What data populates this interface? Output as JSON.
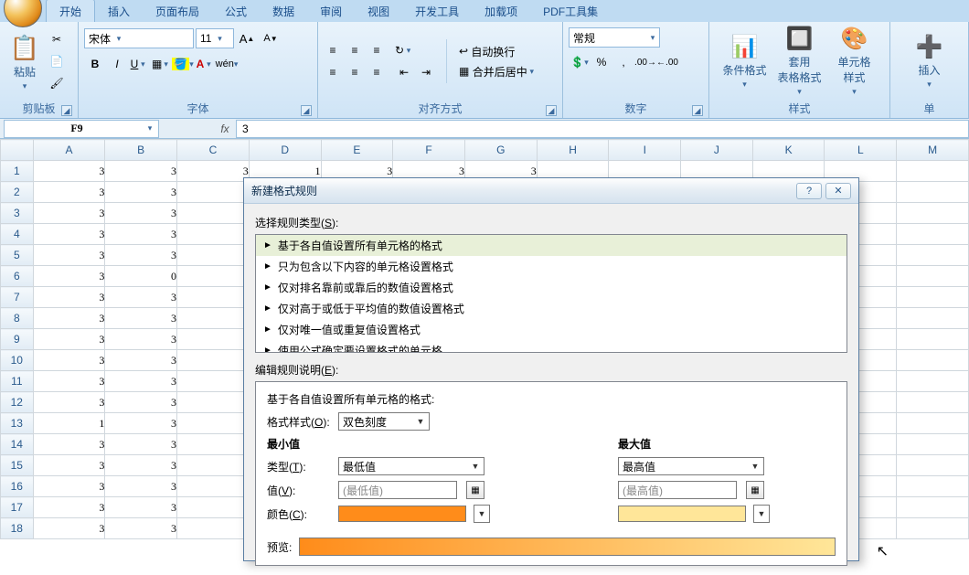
{
  "ribbon": {
    "tabs": [
      "开始",
      "插入",
      "页面布局",
      "公式",
      "数据",
      "审阅",
      "视图",
      "开发工具",
      "加载项",
      "PDF工具集"
    ],
    "active": 0,
    "clipboard": {
      "paste": "粘贴",
      "group": "剪贴板"
    },
    "font": {
      "group": "字体",
      "name": "宋体",
      "size": "11",
      "buttons": {
        "bold": "B",
        "italic": "I",
        "underline": "U"
      }
    },
    "alignment": {
      "group": "对齐方式",
      "wrap": "自动换行",
      "merge": "合并后居中"
    },
    "number": {
      "group": "数字",
      "format": "常规"
    },
    "styles": {
      "group": "样式",
      "cond": "条件格式",
      "table": "套用\n表格格式",
      "cell": "单元格\n样式"
    },
    "cells": {
      "group": "单",
      "insert": "插入"
    }
  },
  "formula_bar": {
    "name": "F9",
    "fx": "fx",
    "value": "3"
  },
  "sheet": {
    "columns": [
      "A",
      "B",
      "C",
      "D",
      "E",
      "F",
      "G",
      "H",
      "I",
      "J",
      "K",
      "L",
      "M"
    ],
    "rows": [
      [
        3,
        3,
        3,
        1,
        3,
        3,
        3,
        null,
        null,
        null,
        null,
        null,
        null
      ],
      [
        3,
        3,
        null,
        null,
        null,
        null,
        null,
        null,
        null,
        null,
        null,
        null,
        null
      ],
      [
        3,
        3,
        null,
        null,
        null,
        null,
        null,
        null,
        null,
        null,
        null,
        null,
        null
      ],
      [
        3,
        3,
        null,
        null,
        null,
        null,
        null,
        null,
        null,
        null,
        null,
        null,
        null
      ],
      [
        3,
        3,
        null,
        null,
        null,
        null,
        null,
        null,
        null,
        null,
        null,
        null,
        null
      ],
      [
        3,
        0,
        null,
        null,
        null,
        null,
        null,
        null,
        null,
        null,
        null,
        null,
        null
      ],
      [
        3,
        3,
        null,
        null,
        null,
        null,
        null,
        null,
        null,
        null,
        null,
        null,
        null
      ],
      [
        3,
        3,
        null,
        null,
        null,
        null,
        null,
        null,
        null,
        null,
        null,
        null,
        null
      ],
      [
        3,
        3,
        null,
        null,
        null,
        null,
        null,
        null,
        null,
        null,
        null,
        null,
        null
      ],
      [
        3,
        3,
        null,
        null,
        null,
        null,
        null,
        null,
        null,
        null,
        null,
        null,
        null
      ],
      [
        3,
        3,
        null,
        null,
        null,
        null,
        null,
        null,
        null,
        null,
        null,
        null,
        null
      ],
      [
        3,
        3,
        null,
        null,
        null,
        null,
        null,
        null,
        null,
        null,
        null,
        null,
        null
      ],
      [
        1,
        3,
        null,
        null,
        null,
        null,
        null,
        null,
        null,
        null,
        null,
        null,
        null
      ],
      [
        3,
        3,
        null,
        null,
        null,
        null,
        null,
        null,
        null,
        null,
        null,
        null,
        null
      ],
      [
        3,
        3,
        null,
        null,
        null,
        null,
        null,
        null,
        null,
        null,
        null,
        null,
        null
      ],
      [
        3,
        3,
        null,
        null,
        null,
        null,
        null,
        null,
        null,
        null,
        null,
        null,
        null
      ],
      [
        3,
        3,
        null,
        null,
        null,
        null,
        null,
        null,
        null,
        null,
        null,
        null,
        null
      ],
      [
        3,
        3,
        null,
        null,
        null,
        null,
        null,
        null,
        null,
        null,
        null,
        null,
        null
      ]
    ]
  },
  "dialog": {
    "title": "新建格式规则",
    "section1_pre": "选择规则类型(",
    "section1_key": "S",
    "section1_post": "):",
    "rule_types": [
      "基于各自值设置所有单元格的格式",
      "只为包含以下内容的单元格设置格式",
      "仅对排名靠前或靠后的数值设置格式",
      "仅对高于或低于平均值的数值设置格式",
      "仅对唯一值或重复值设置格式",
      "使用公式确定要设置格式的单元格"
    ],
    "selected_rule": 0,
    "section2_pre": "编辑规则说明(",
    "section2_key": "E",
    "section2_post": "):",
    "desc_title": "基于各自值设置所有单元格的格式:",
    "format_style_pre": "格式样式(",
    "format_style_key": "O",
    "format_style_post": "):",
    "format_style_value": "双色刻度",
    "col_min": "最小值",
    "col_max": "最大值",
    "type_pre": "类型(",
    "type_key": "T",
    "type_post": "):",
    "type_min_value": "最低值",
    "type_max_value": "最高值",
    "value_pre": "值(",
    "value_key": "V",
    "value_post": "):",
    "value_min_placeholder": "(最低值)",
    "value_max_placeholder": "(最高值)",
    "color_pre": "颜色(",
    "color_key": "C",
    "color_post": "):",
    "color_min": "#ff8c1a",
    "color_max": "#ffe699",
    "preview_label": "预览:",
    "preview_from": "#ff8c1a",
    "preview_to": "#ffe699"
  }
}
